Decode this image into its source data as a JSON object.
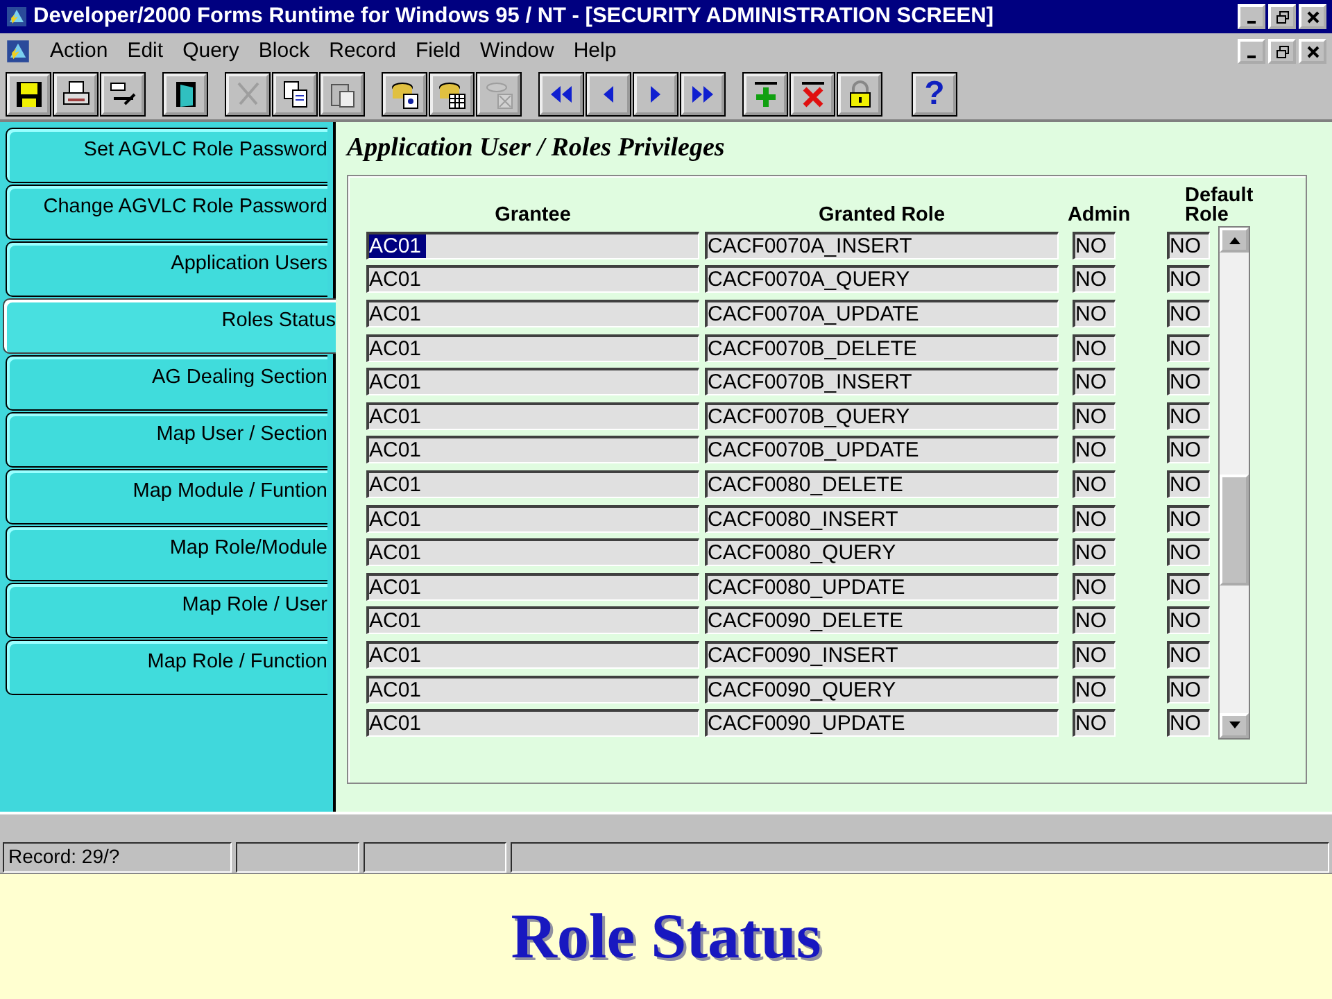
{
  "window": {
    "title": "Developer/2000 Forms Runtime for Windows 95 / NT - [SECURITY ADMINISTRATION SCREEN]"
  },
  "menu": [
    "Action",
    "Edit",
    "Query",
    "Block",
    "Record",
    "Field",
    "Window",
    "Help"
  ],
  "toolbar": [
    {
      "kind": "save"
    },
    {
      "kind": "print"
    },
    {
      "kind": "tools"
    },
    {
      "kind": "sep"
    },
    {
      "kind": "exit"
    },
    {
      "kind": "sep"
    },
    {
      "kind": "cut",
      "disabled": true
    },
    {
      "kind": "copy",
      "disabled": false
    },
    {
      "kind": "paste",
      "disabled": false
    },
    {
      "kind": "sep"
    },
    {
      "kind": "query",
      "disabled": false
    },
    {
      "kind": "execute",
      "disabled": false
    },
    {
      "kind": "cancel",
      "disabled": true
    },
    {
      "kind": "sep"
    },
    {
      "kind": "first"
    },
    {
      "kind": "prev"
    },
    {
      "kind": "next"
    },
    {
      "kind": "last"
    },
    {
      "kind": "sep"
    },
    {
      "kind": "insert"
    },
    {
      "kind": "delete"
    },
    {
      "kind": "lock"
    },
    {
      "kind": "sep"
    },
    {
      "kind": "help",
      "label": "?"
    }
  ],
  "sidebar": {
    "tabs": [
      {
        "label": "Set AGVLC Role Password",
        "selected": false
      },
      {
        "label": "Change AGVLC Role Password",
        "selected": false
      },
      {
        "label": "Application Users",
        "selected": false
      },
      {
        "label": "Roles Status",
        "selected": true
      },
      {
        "label": "AG Dealing Section",
        "selected": false
      },
      {
        "label": "Map User / Section",
        "selected": false
      },
      {
        "label": "Map Module / Funtion",
        "selected": false
      },
      {
        "label": "Map Role/Module",
        "selected": false
      },
      {
        "label": "Map Role / User",
        "selected": false
      },
      {
        "label": "Map Role / Function",
        "selected": false
      }
    ]
  },
  "panel": {
    "title": "Application User / Roles Privileges",
    "columns": [
      "Grantee",
      "Granted  Role",
      "Admin",
      "Default Role"
    ],
    "rows": [
      {
        "grantee": "AC01",
        "role": "CACF0070A_INSERT",
        "admin": "NO",
        "default_role": "NO",
        "selected": true
      },
      {
        "grantee": "AC01",
        "role": "CACF0070A_QUERY",
        "admin": "NO",
        "default_role": "NO",
        "selected": false
      },
      {
        "grantee": "AC01",
        "role": "CACF0070A_UPDATE",
        "admin": "NO",
        "default_role": "NO",
        "selected": false
      },
      {
        "grantee": "AC01",
        "role": "CACF0070B_DELETE",
        "admin": "NO",
        "default_role": "NO",
        "selected": false
      },
      {
        "grantee": "AC01",
        "role": "CACF0070B_INSERT",
        "admin": "NO",
        "default_role": "NO",
        "selected": false
      },
      {
        "grantee": "AC01",
        "role": "CACF0070B_QUERY",
        "admin": "NO",
        "default_role": "NO",
        "selected": false
      },
      {
        "grantee": "AC01",
        "role": "CACF0070B_UPDATE",
        "admin": "NO",
        "default_role": "NO",
        "selected": false
      },
      {
        "grantee": "AC01",
        "role": "CACF0080_DELETE",
        "admin": "NO",
        "default_role": "NO",
        "selected": false
      },
      {
        "grantee": "AC01",
        "role": "CACF0080_INSERT",
        "admin": "NO",
        "default_role": "NO",
        "selected": false
      },
      {
        "grantee": "AC01",
        "role": "CACF0080_QUERY",
        "admin": "NO",
        "default_role": "NO",
        "selected": false
      },
      {
        "grantee": "AC01",
        "role": "CACF0080_UPDATE",
        "admin": "NO",
        "default_role": "NO",
        "selected": false
      },
      {
        "grantee": "AC01",
        "role": "CACF0090_DELETE",
        "admin": "NO",
        "default_role": "NO",
        "selected": false
      },
      {
        "grantee": "AC01",
        "role": "CACF0090_INSERT",
        "admin": "NO",
        "default_role": "NO",
        "selected": false
      },
      {
        "grantee": "AC01",
        "role": "CACF0090_QUERY",
        "admin": "NO",
        "default_role": "NO",
        "selected": false
      },
      {
        "grantee": "AC01",
        "role": "CACF0090_UPDATE",
        "admin": "NO",
        "default_role": "NO",
        "selected": false
      }
    ]
  },
  "status_bar": {
    "record": "Record: 29/?"
  },
  "caption": "Role Status"
}
